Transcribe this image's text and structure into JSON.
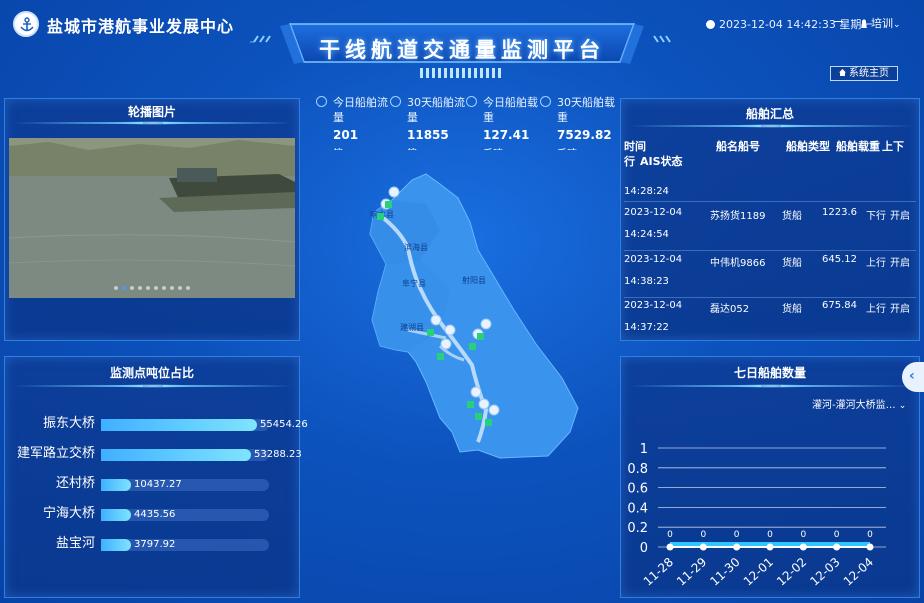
{
  "header": {
    "org_name": "盐城市港航事业发展中心",
    "title": "干线航道交通量监测平台",
    "datetime": "2023-12-04 14:42:33 星期一",
    "user": "培训",
    "user_caret": "⌄",
    "home_button": "系统主页",
    "icons": [
      "logo-anchor-icon",
      "clock-icon",
      "user-icon",
      "home-icon"
    ]
  },
  "carousel": {
    "title": "轮播图片",
    "slide_count": 10,
    "active_index": 1
  },
  "tonnage": {
    "title": "监测点吨位占比",
    "max": 55454.26,
    "items": [
      {
        "label": "振东大桥",
        "value": "55454.26",
        "num": 55454.26
      },
      {
        "label": "建军路立交桥",
        "value": "53288.23",
        "num": 53288.23
      },
      {
        "label": "还村桥",
        "value": "10437.27",
        "num": 10437.27
      },
      {
        "label": "宁海大桥",
        "value": "4435.56",
        "num": 4435.56
      },
      {
        "label": "盐宝河",
        "value": "3797.92",
        "num": 3797.92
      }
    ]
  },
  "stats": [
    {
      "label": "今日船舶流量",
      "value": "201",
      "unit": "艘",
      "icon": "ship-flow-icon"
    },
    {
      "label": "30天船舶流量",
      "value": "11855",
      "unit": "艘",
      "icon": "ship-month-icon"
    },
    {
      "label": "今日船舶载重",
      "value": "127.41",
      "unit": "千吨",
      "icon": "anchor-icon"
    },
    {
      "label": "30天船舶载重",
      "value": "7529.82",
      "unit": "千吨",
      "icon": "anchor-month-icon"
    }
  ],
  "map": {
    "labels": [
      "响水县",
      "滨海县",
      "阜宁县",
      "射阳县",
      "建湖县"
    ],
    "colors": {
      "land": "#3a93ec",
      "water": "#cfe6ff",
      "marker": "#27d17a"
    }
  },
  "ships": {
    "title": "船舶汇总",
    "columns": [
      "时间",
      "船名船号",
      "船舶类型",
      "船舶载重",
      "上下行",
      "AIS状态"
    ],
    "rows": [
      {
        "date": "",
        "time": "14:28:24",
        "name": "",
        "type": "",
        "weight": "",
        "dir": "",
        "ais": ""
      },
      {
        "date": "2023-12-04",
        "time": "14:24:54",
        "name": "苏扬货1189",
        "type": "货船",
        "weight": "1223.6",
        "dir": "下行",
        "ais": "开启"
      },
      {
        "date": "2023-12-04",
        "time": "14:38:23",
        "name": "中伟机9866",
        "type": "货船",
        "weight": "645.12",
        "dir": "上行",
        "ais": "开启"
      },
      {
        "date": "2023-12-04",
        "time": "14:37:22",
        "name": "磊达052",
        "type": "货船",
        "weight": "675.84",
        "dir": "上行",
        "ais": "开启"
      }
    ]
  },
  "weekly": {
    "title": "七日船舶数量",
    "select_value": "灌河-灌河大桥监…",
    "select_caret": "⌄",
    "collapse_glyph": "‹"
  },
  "chart_data": {
    "type": "line",
    "title": "七日船舶数量",
    "categories": [
      "11-28",
      "11-29",
      "11-30",
      "12-01",
      "12-02",
      "12-03",
      "12-04"
    ],
    "values": [
      0,
      0,
      0,
      0,
      0,
      0,
      0
    ],
    "yticks": [
      0,
      0.2,
      0.4,
      0.6,
      0.8,
      1
    ],
    "ylim": [
      0,
      1
    ],
    "grid": true,
    "colors": {
      "line": "#ffffff",
      "area": "#2fc6ff"
    }
  }
}
